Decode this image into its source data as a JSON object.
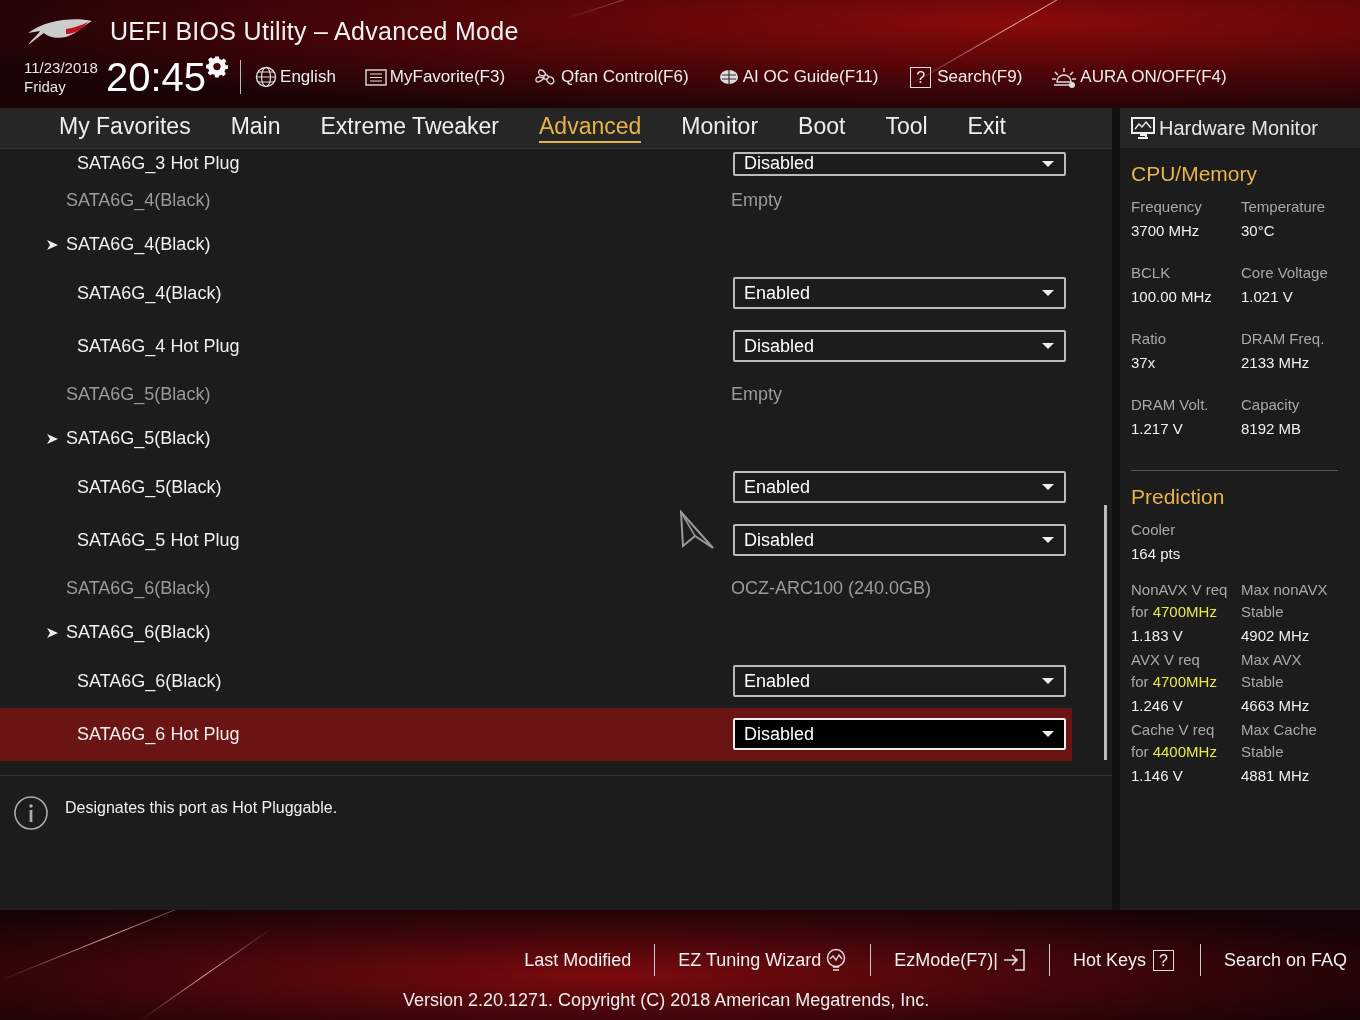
{
  "header": {
    "title": "UEFI BIOS Utility – Advanced Mode",
    "date": "11/23/2018",
    "day": "Friday",
    "time": "20:45",
    "tools": [
      {
        "kind": "language",
        "label": "English"
      },
      {
        "kind": "favorite",
        "label": "MyFavorite(F3)"
      },
      {
        "kind": "fan",
        "label": "Qfan Control(F6)"
      },
      {
        "kind": "guide",
        "label": "AI OC Guide(F11)"
      },
      {
        "kind": "search",
        "label": "Search(F9)",
        "icon_text": "?"
      },
      {
        "kind": "aura",
        "label": "AURA ON/OFF(F4)"
      }
    ]
  },
  "tabs": [
    {
      "label": "My Favorites",
      "selected": false
    },
    {
      "label": "Main",
      "selected": false
    },
    {
      "label": "Extreme Tweaker",
      "selected": false
    },
    {
      "label": "Advanced",
      "selected": true
    },
    {
      "label": "Monitor",
      "selected": false
    },
    {
      "label": "Boot",
      "selected": false
    },
    {
      "label": "Tool",
      "selected": false
    },
    {
      "label": "Exit",
      "selected": false
    }
  ],
  "settings": [
    {
      "kind": "option",
      "label": "SATA6G_3 Hot Plug",
      "value": "Disabled",
      "selected": false
    },
    {
      "kind": "info",
      "label": "SATA6G_4(Black)",
      "value": "Empty",
      "selected": false
    },
    {
      "kind": "submenu",
      "label": "SATA6G_4(Black)",
      "selected": false
    },
    {
      "kind": "option",
      "label": "SATA6G_4(Black)",
      "value": "Enabled",
      "selected": false
    },
    {
      "kind": "option",
      "label": "SATA6G_4 Hot Plug",
      "value": "Disabled",
      "selected": false
    },
    {
      "kind": "info",
      "label": "SATA6G_5(Black)",
      "value": "Empty",
      "selected": false
    },
    {
      "kind": "submenu",
      "label": "SATA6G_5(Black)",
      "selected": false
    },
    {
      "kind": "option",
      "label": "SATA6G_5(Black)",
      "value": "Enabled",
      "selected": false
    },
    {
      "kind": "option",
      "label": "SATA6G_5 Hot Plug",
      "value": "Disabled",
      "selected": false
    },
    {
      "kind": "info",
      "label": "SATA6G_6(Black)",
      "value": "OCZ-ARC100 (240.0GB)",
      "selected": false
    },
    {
      "kind": "submenu",
      "label": "SATA6G_6(Black)",
      "selected": false
    },
    {
      "kind": "option",
      "label": "SATA6G_6(Black)",
      "value": "Enabled",
      "selected": false
    },
    {
      "kind": "option",
      "label": "SATA6G_6 Hot Plug",
      "value": "Disabled",
      "selected": true
    }
  ],
  "help": {
    "text": "Designates this port as Hot Pluggable."
  },
  "hardware_monitor": {
    "title": "Hardware Monitor",
    "sections": [
      {
        "title": "CPU/Memory",
        "items": [
          {
            "label": "Frequency",
            "value": "3700 MHz"
          },
          {
            "label": "Temperature",
            "value": "30°C"
          },
          {
            "label": "BCLK",
            "value": "100.00 MHz"
          },
          {
            "label": "Core Voltage",
            "value": "1.021 V"
          },
          {
            "label": "Ratio",
            "value": "37x"
          },
          {
            "label": "DRAM Freq.",
            "value": "2133 MHz"
          },
          {
            "label": "DRAM Volt.",
            "value": "1.217 V"
          },
          {
            "label": "Capacity",
            "value": "8192 MB"
          }
        ]
      },
      {
        "title": "Prediction",
        "lead": {
          "label": "Cooler",
          "value": "164 pts"
        },
        "items": [
          {
            "label": "NonAVX V req",
            "label_2": "for **4700MHz**",
            "value": "1.183 V"
          },
          {
            "label": "Max nonAVX",
            "label_2": "Stable",
            "value": "4902 MHz"
          },
          {
            "label": "AVX V req",
            "label_2": "for **4700MHz**",
            "value": "1.246 V"
          },
          {
            "label": "Max AVX",
            "label_2": "Stable",
            "value": "4663 MHz"
          },
          {
            "label": "Cache V req",
            "label_2": "for **4400MHz**",
            "value": "1.146 V"
          },
          {
            "label": "Max Cache",
            "label_2": "Stable",
            "value": "4881 MHz"
          }
        ]
      }
    ]
  },
  "footer": {
    "items": [
      {
        "kind": "text",
        "label": "Last Modified"
      },
      {
        "kind": "wizard",
        "label": "EZ Tuning Wizard"
      },
      {
        "kind": "ezmode",
        "label": "EzMode(F7)|"
      },
      {
        "kind": "hotkeys",
        "label": "Hot Keys",
        "icon_text": "?"
      },
      {
        "kind": "text",
        "label": "Search on FAQ"
      }
    ],
    "version": "Version 2.20.1271. Copyright (C) 2018 American Megatrends, Inc."
  }
}
